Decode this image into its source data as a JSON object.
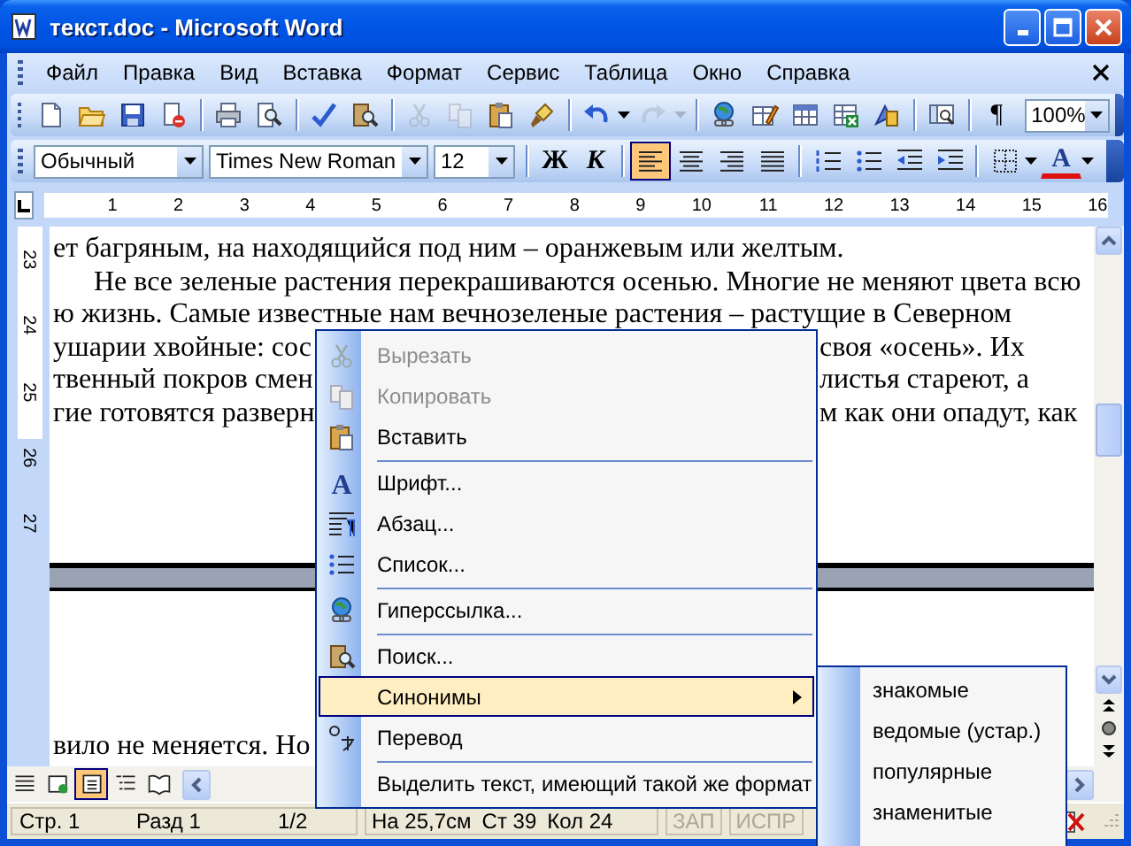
{
  "window": {
    "title": "текст.doc - Microsoft Word"
  },
  "menu_bar": {
    "items": [
      "Файл",
      "Правка",
      "Вид",
      "Вставка",
      "Формат",
      "Сервис",
      "Таблица",
      "Окно",
      "Справка"
    ]
  },
  "standard_toolbar": {
    "buttons": [
      {
        "disabled": false
      },
      {
        "disabled": false
      },
      {
        "disabled": false
      },
      {
        "disabled": false
      },
      {
        "disabled": false
      },
      {
        "disabled": false
      },
      {
        "disabled": false
      },
      {
        "disabled": false
      },
      {
        "disabled": true
      },
      {
        "disabled": true
      },
      {
        "disabled": false
      },
      {
        "disabled": false
      },
      {
        "disabled": false
      },
      {
        "disabled": true
      },
      {
        "disabled": false
      },
      {
        "disabled": false
      },
      {
        "disabled": false
      },
      {
        "disabled": false
      },
      {
        "disabled": false
      },
      {
        "disabled": false
      }
    ],
    "show_marks": "¶",
    "zoom": "100%"
  },
  "formatting_toolbar": {
    "style": "Обычный",
    "font": "Times New Roman",
    "size": "12",
    "bold": "Ж",
    "italic": "К",
    "alignment": [
      {
        "selected": true
      },
      {
        "selected": false
      },
      {
        "selected": false
      },
      {
        "selected": false
      }
    ],
    "font_color": "A"
  },
  "horizontal_ruler": {
    "marks": [
      "1",
      "2",
      "3",
      "4",
      "5",
      "6",
      "7",
      "8",
      "9",
      "10",
      "11",
      "12",
      "13",
      "14",
      "15",
      "16"
    ]
  },
  "vertical_ruler": {
    "marks": [
      "23",
      "24",
      "25",
      "26",
      "27"
    ]
  },
  "document": {
    "page_1_lines": [
      {
        "text": "ет багряным, на находящийся под ним – оранжевым или желтым.",
        "indent": false
      },
      {
        "text": "Не все зеленые растения перекрашиваются осенью. Многие не меняют цвета всю",
        "indent": true
      },
      {
        "text": "ю жизнь. Самые известные нам вечнозеленые растения – растущие в Северном",
        "indent": false
      },
      {
        "left": "ушарии хвойные: сос",
        "right": "своя «осень». Их"
      },
      {
        "left": "твенный покров смен",
        "right": "листья стареют, а"
      },
      {
        "left": "гие готовятся разверн",
        "right": "м как они опадут, как"
      }
    ],
    "page_2_lines": [
      {
        "text": "вило не меняется. Но",
        "indent": false
      }
    ]
  },
  "context_menu": {
    "items": [
      {
        "label": "Вырезать",
        "disabled": true,
        "separator_before": false,
        "selected": false,
        "submenu": false
      },
      {
        "label": "Копировать",
        "disabled": true,
        "separator_before": false,
        "selected": false,
        "submenu": false
      },
      {
        "label": "Вставить",
        "disabled": false,
        "separator_before": false,
        "selected": false,
        "submenu": false
      },
      {
        "label": "Шрифт...",
        "disabled": false,
        "separator_before": true,
        "selected": false,
        "submenu": false,
        "icon_text": "A"
      },
      {
        "label": "Абзац...",
        "disabled": false,
        "separator_before": false,
        "selected": false,
        "submenu": false
      },
      {
        "label": "Список...",
        "disabled": false,
        "separator_before": false,
        "selected": false,
        "submenu": false
      },
      {
        "label": "Гиперссылка...",
        "disabled": false,
        "separator_before": true,
        "selected": false,
        "submenu": false
      },
      {
        "label": "Поиск...",
        "disabled": false,
        "separator_before": true,
        "selected": false,
        "submenu": false
      },
      {
        "label": "Синонимы",
        "disabled": false,
        "separator_before": false,
        "selected": true,
        "submenu": true
      },
      {
        "label": "Перевод",
        "disabled": false,
        "separator_before": false,
        "selected": false,
        "submenu": false
      },
      {
        "label": "Выделить текст, имеющий такой же формат",
        "disabled": false,
        "separator_before": true,
        "selected": false,
        "submenu": false
      }
    ]
  },
  "submenu": {
    "items": [
      "знакомые",
      "ведомые (устар.)",
      "популярные",
      "знаменитые"
    ]
  },
  "view_buttons": [
    {
      "selected": false
    },
    {
      "selected": false
    },
    {
      "selected": true
    },
    {
      "selected": false
    },
    {
      "selected": false
    }
  ],
  "status_bar": {
    "sections": [
      [
        "Стр. 1",
        "Разд 1",
        "1/2"
      ],
      [
        "На 25,7см",
        "Ст 39",
        "Кол 24"
      ]
    ],
    "modes": [
      {
        "text": "ЗАП",
        "on": false
      },
      {
        "text": "ИСПР",
        "on": false
      }
    ]
  }
}
